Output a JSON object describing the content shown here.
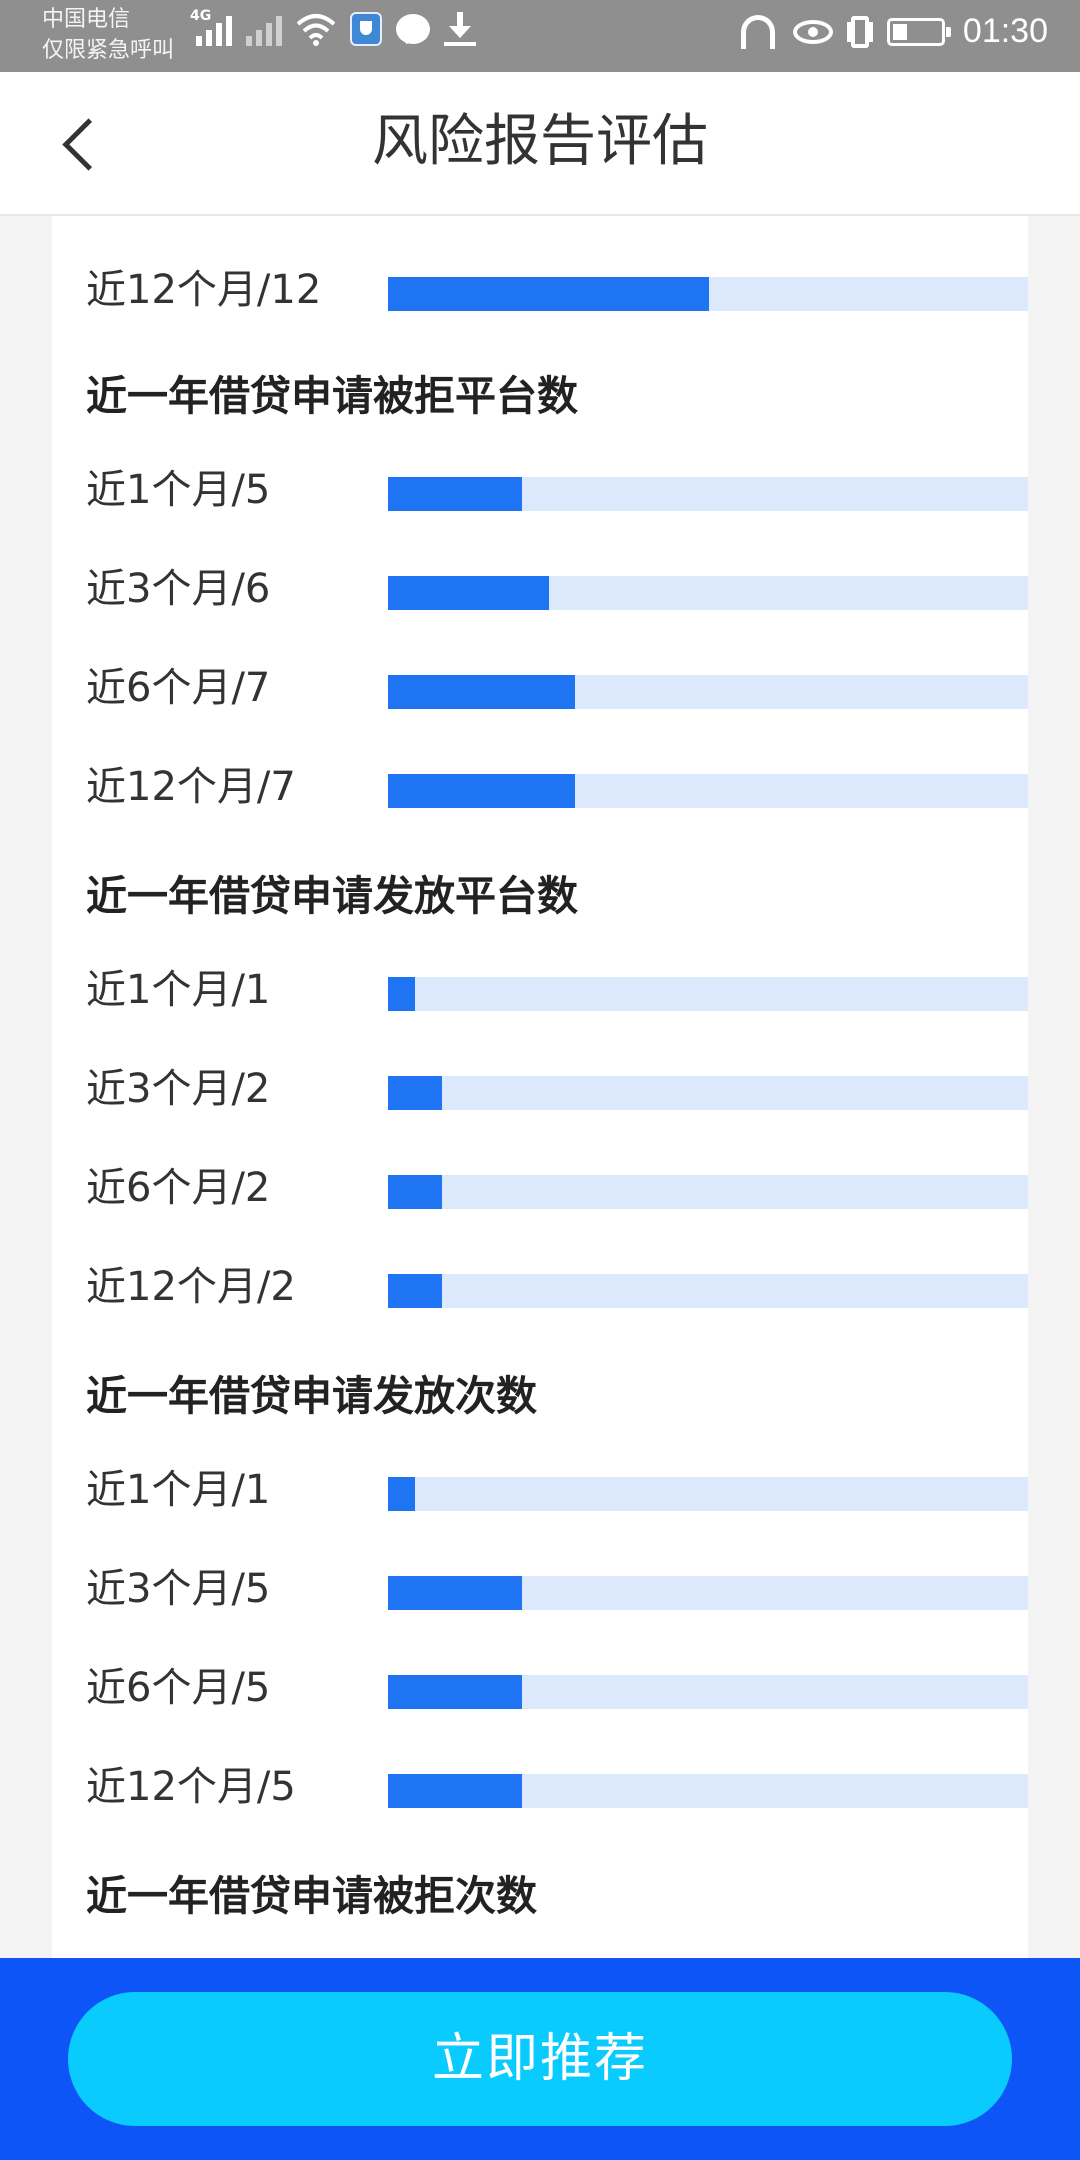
{
  "status_bar": {
    "carrier_line1": "中国电信",
    "carrier_line2": "仅限紧急呼叫",
    "network_tag": "4G",
    "time": "01:30"
  },
  "header": {
    "title": "风险报告评估"
  },
  "partial_row": {
    "label": "近12个月/12",
    "value": 12
  },
  "sections": [
    {
      "title": "近一年借贷申请被拒平台数",
      "rows": [
        {
          "label": "近1个月/5",
          "value": 5
        },
        {
          "label": "近3个月/6",
          "value": 6
        },
        {
          "label": "近6个月/7",
          "value": 7
        },
        {
          "label": "近12个月/7",
          "value": 7
        }
      ]
    },
    {
      "title": "近一年借贷申请发放平台数",
      "rows": [
        {
          "label": "近1个月/1",
          "value": 1
        },
        {
          "label": "近3个月/2",
          "value": 2
        },
        {
          "label": "近6个月/2",
          "value": 2
        },
        {
          "label": "近12个月/2",
          "value": 2
        }
      ]
    },
    {
      "title": "近一年借贷申请发放次数",
      "rows": [
        {
          "label": "近1个月/1",
          "value": 1
        },
        {
          "label": "近3个月/5",
          "value": 5
        },
        {
          "label": "近6个月/5",
          "value": 5
        },
        {
          "label": "近12个月/5",
          "value": 5
        }
      ]
    },
    {
      "title": "近一年借贷申请被拒次数",
      "rows": []
    }
  ],
  "bar_scale_max": 24,
  "colors": {
    "bar_fill": "#1f74f3",
    "bar_track": "#dce8fb",
    "bottom_bar": "#0d55f7",
    "button": "#09cbfd"
  },
  "cta": {
    "label": "立即推荐"
  }
}
